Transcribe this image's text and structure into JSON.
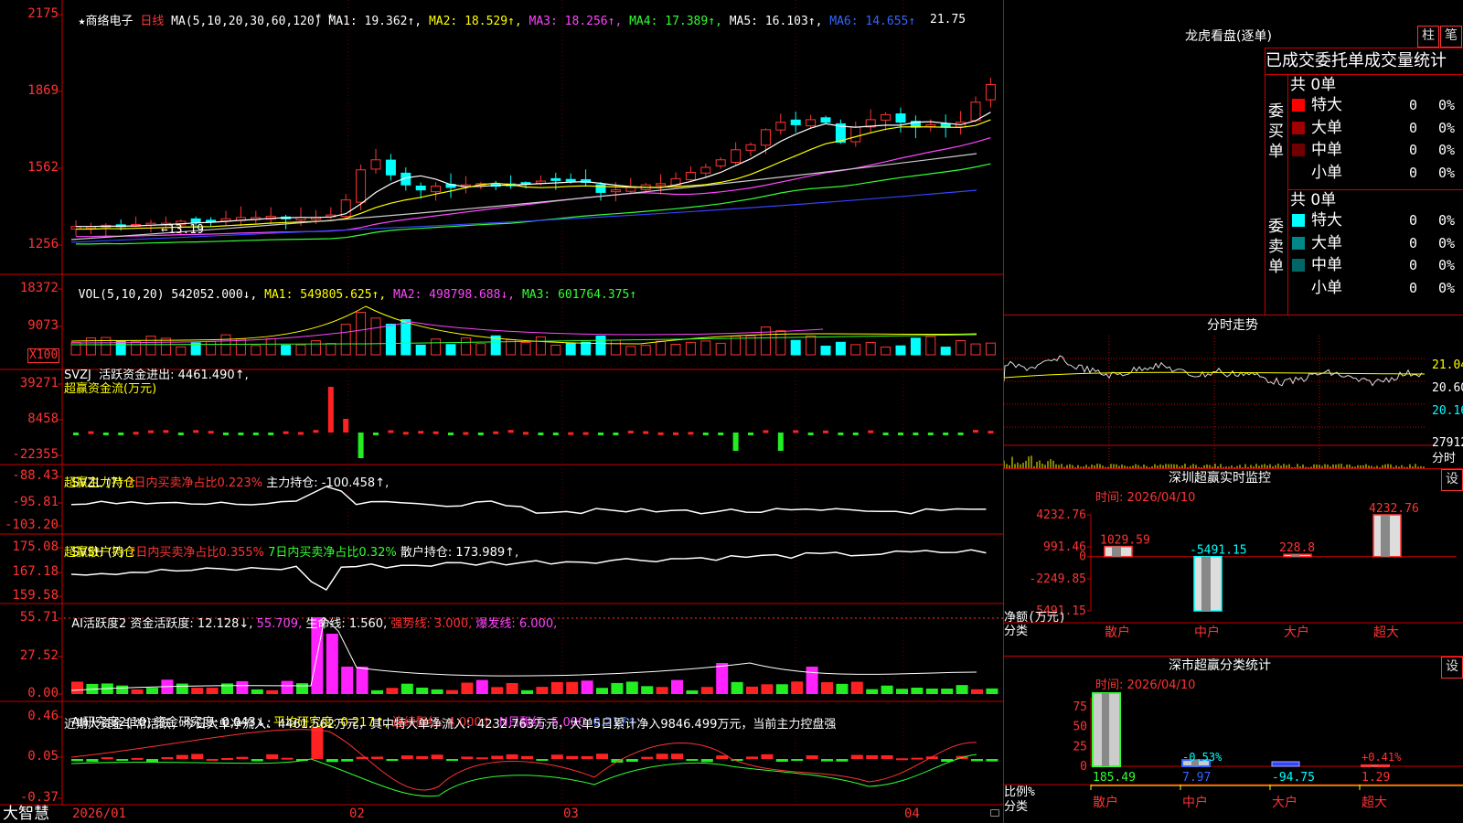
{
  "kline": {
    "title_star": "★",
    "stock_name": "商络电子",
    "period": "日线",
    "ma_params": "MA(5,10,20,30,60,120)",
    "ma1": "MA1: 19.362↑,",
    "ma2": "MA2: 18.529↑,",
    "ma3": "MA3: 18.256↑,",
    "ma4": "MA4: 17.389↑,",
    "ma5": "MA5: 16.103↑,",
    "ma6": "MA6: 14.655↑",
    "y_ticks": [
      "2175",
      "1869",
      "1562",
      "1256"
    ],
    "high_label": "21.75",
    "low_label": "←13.19",
    "marks": "* *"
  },
  "volume": {
    "title": "VOL(5,10,20)",
    "value": "542052.000↓,",
    "ma1": "MA1: 549805.625↑,",
    "ma2": "MA2: 498798.688↓,",
    "ma3": "MA3: 601764.375↑",
    "y_ticks": [
      "18372",
      "9073"
    ],
    "unit": "X100"
  },
  "svzj": {
    "title": "SVZJ  活跃资金进出: 4461.490↑,",
    "subtitle": "超赢资金流(万元)",
    "y_ticks": [
      "39271",
      "8458",
      "-22355"
    ]
  },
  "svzl": {
    "title_a": "SVZL (7)",
    "title_b": "7日内买卖净占比0.223%",
    "title_c": "主力持仓: -100.458↑,",
    "subtitle": "超赢主力持仓",
    "y_ticks": [
      "-88.43",
      "-95.81",
      "-103.20"
    ]
  },
  "svsh": {
    "title_a": "SVSH (7)",
    "title_b": "7日内买卖净占比0.355%",
    "title_c": "7日内买卖净占比0.32%",
    "title_d": "散户持仓: 173.989↑,",
    "subtitle": "超赢散户持仓",
    "y_ticks": [
      "175.08",
      "167.18",
      "159.58"
    ]
  },
  "ai1": {
    "title": "AI活跃度2",
    "t1": "资金活跃度: 12.128↓,",
    "t2": "55.709,",
    "t3": "生命线: 1.560,",
    "t4": "强势线: 3.000,",
    "t5": "爆发线: 6.000,",
    "y_ticks": [
      "55.71",
      "27.52",
      "0.00"
    ]
  },
  "ai2": {
    "title": "AI研究度2(10)",
    "t1": "资金研究度: 0.043↓,",
    "t2": "平均研究度: 0.217↑,",
    "t3": "连续飘红: 4.000↑,",
    "t4": "N日飘红: 5.000,",
    "t5": "0.217↑",
    "comment": "近期大资金非常活跃，今日大单净流入：4461.562万元，其中特大单净流入：4232.763万元，大单5日累计净入9846.499万元，当前主力控盘强",
    "y_ticks": [
      "0.46",
      "0.05",
      "-0.37"
    ]
  },
  "xaxis": {
    "logo": "大智慧",
    "labels": [
      "2026/01",
      "02",
      "03",
      "04"
    ]
  },
  "lhb": {
    "title": "龙虎看盘(逐单)",
    "btn1": "柱",
    "btn2": "笔",
    "header": "已成交委托单成交量统计",
    "buy_label": "委买单",
    "sell_label": "委卖单",
    "buy_total": "共 0单",
    "sell_total": "共 0单",
    "buy_rows": [
      {
        "name": "特大",
        "count": "0",
        "pct": "0%",
        "color": "#ff0000"
      },
      {
        "name": "大单",
        "count": "0",
        "pct": "0%",
        "color": "#a00000"
      },
      {
        "name": "中单",
        "count": "0",
        "pct": "0%",
        "color": "#700000"
      },
      {
        "name": "小单",
        "count": "0",
        "pct": "0%",
        "color": "#000000"
      }
    ],
    "sell_rows": [
      {
        "name": "特大",
        "count": "0",
        "pct": "0%",
        "color": "#00ffff"
      },
      {
        "name": "大单",
        "count": "0",
        "pct": "0%",
        "color": "#008888"
      },
      {
        "name": "中单",
        "count": "0",
        "pct": "0%",
        "color": "#006666"
      },
      {
        "name": "小单",
        "count": "0",
        "pct": "0%",
        "color": "#000000"
      }
    ]
  },
  "fenshi": {
    "title": "分时走势",
    "prices": [
      "21.04",
      "20.60",
      "20.16"
    ],
    "vol": "27912",
    "vol_unit": "分时"
  },
  "monitor": {
    "title": "深圳超赢实时监控",
    "btn": "设",
    "time": "时间: 2026/04/10",
    "y_ticks": [
      "4232.76",
      "991.46",
      "0",
      "-2249.85",
      "-5491.15"
    ],
    "ylabel1": "净额(万元)",
    "ylabel2": "分类",
    "categories": [
      "散户",
      "中户",
      "大户",
      "超大"
    ],
    "values": [
      "1029.59",
      "-5491.15",
      "228.8",
      "4232.76"
    ]
  },
  "classify": {
    "title": "深市超赢分类统计",
    "btn": "设",
    "time": "时间: 2026/04/10",
    "y_ticks": [
      "75",
      "50",
      "25",
      "0"
    ],
    "ylabel1": "比例%",
    "ylabel2": "分类",
    "pct_labels": [
      "",
      "-0.53%",
      "",
      "+0.41%"
    ],
    "values": [
      "185.49",
      "7.97",
      "-94.75",
      "1.29"
    ],
    "categories": [
      "散户",
      "中户",
      "大户",
      "超大"
    ]
  },
  "chart_data": [
    {
      "type": "bar",
      "title": "深圳超赢实时监控",
      "ylabel": "净额(万元)",
      "categories": [
        "散户",
        "中户",
        "大户",
        "超大"
      ],
      "values": [
        1029.59,
        -5491.15,
        228.8,
        4232.76
      ],
      "ylim": [
        -5491.15,
        4232.76
      ]
    },
    {
      "type": "bar",
      "title": "深市超赢分类统计",
      "ylabel": "比例%",
      "categories": [
        "散户",
        "中户",
        "大户",
        "超大"
      ],
      "values": [
        185.49,
        7.97,
        -94.75,
        1.29
      ],
      "ylim": [
        0,
        75
      ]
    }
  ]
}
